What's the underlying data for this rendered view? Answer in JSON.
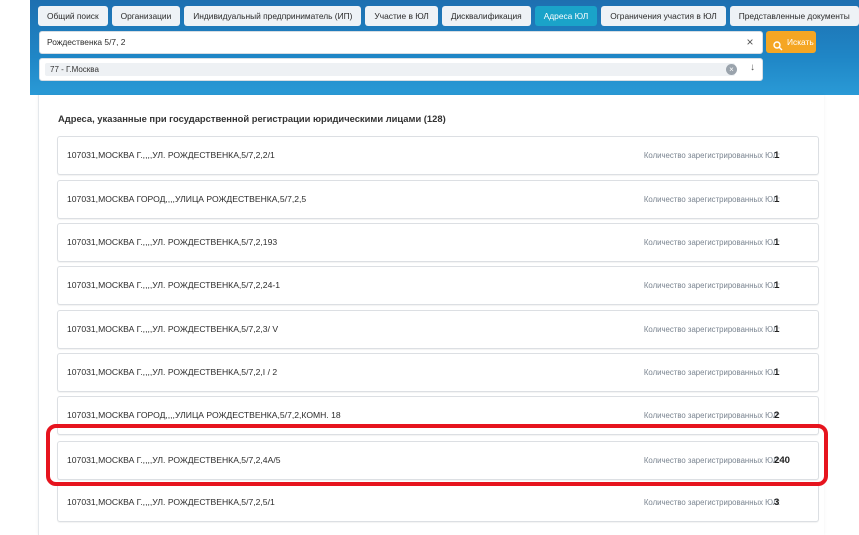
{
  "tabs": [
    {
      "label": "Общий поиск",
      "active": false
    },
    {
      "label": "Организации",
      "active": false
    },
    {
      "label": "Индивидуальный предприниматель (ИП)",
      "active": false
    },
    {
      "label": "Участие в ЮЛ",
      "active": false
    },
    {
      "label": "Дисквалификация",
      "active": false
    },
    {
      "label": "Адреса ЮЛ",
      "active": true
    },
    {
      "label": "Ограничения участия в ЮЛ",
      "active": false
    },
    {
      "label": "Представленные документы",
      "active": false
    }
  ],
  "search": {
    "value": "Рождественка 5/7, 2",
    "clear_symbol": "×",
    "button_label": "Искать"
  },
  "region": {
    "selected": "77 - Г.Москва",
    "clear_symbol": "×",
    "arrow_symbol": "↓"
  },
  "results": {
    "title": "Адреса, указанные при государственной регистрации юридическими лицами (128)",
    "count_label": "Количество зарегистрированных ЮЛ:",
    "rows": [
      {
        "address": "107031,МОСКВА Г.,,,,УЛ. РОЖДЕСТВЕНКА,5/7,2,2/1",
        "count": "1"
      },
      {
        "address": "107031,МОСКВА ГОРОД,,,,УЛИЦА РОЖДЕСТВЕНКА,5/7,2,5",
        "count": "1"
      },
      {
        "address": "107031,МОСКВА Г.,,,,УЛ. РОЖДЕСТВЕНКА,5/7,2,193",
        "count": "1"
      },
      {
        "address": "107031,МОСКВА Г.,,,,УЛ. РОЖДЕСТВЕНКА,5/7,2,24-1",
        "count": "1"
      },
      {
        "address": "107031,МОСКВА Г.,,,,УЛ. РОЖДЕСТВЕНКА,5/7,2,3/ V",
        "count": "1"
      },
      {
        "address": "107031,МОСКВА Г.,,,,УЛ. РОЖДЕСТВЕНКА,5/7,2,I / 2",
        "count": "1"
      },
      {
        "address": "107031,МОСКВА ГОРОД,,,,УЛИЦА РОЖДЕСТВЕНКА,5/7,2,КОМН. 18",
        "count": "2"
      },
      {
        "address": "107031,МОСКВА Г.,,,,УЛ. РОЖДЕСТВЕНКА,5/7,2,4А/5",
        "count": "240"
      },
      {
        "address": "107031,МОСКВА Г.,,,,УЛ. РОЖДЕСТВЕНКА,5/7,2,5/1",
        "count": "3"
      }
    ]
  },
  "colors": {
    "header_blue": "#1f86c6",
    "active_tab": "#1aa3c9",
    "search_button": "#f5a623",
    "highlight": "#e6141e"
  }
}
